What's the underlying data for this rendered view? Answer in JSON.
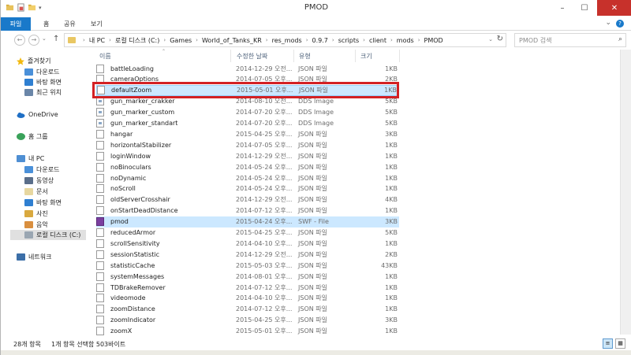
{
  "window": {
    "title": "PMOD",
    "controls": {
      "minimize": "–",
      "maximize": "☐",
      "close": "✕"
    }
  },
  "ribbon": {
    "tabs": [
      "파일",
      "홈",
      "공유",
      "보기"
    ],
    "help": "?",
    "expand": "⌄"
  },
  "address_bar": {
    "back": "←",
    "forward": "→",
    "recent": "⌄",
    "up": "↑",
    "breadcrumb": [
      "내 PC",
      "로컬 디스크 (C:)",
      "Games",
      "World_of_Tanks_KR",
      "res_mods",
      "0.9.7",
      "scripts",
      "client",
      "mods",
      "PMOD"
    ],
    "refresh": "↻",
    "search_placeholder": "PMOD 검색"
  },
  "nav_pane": {
    "favorites": {
      "label": "즐겨찾기",
      "items": [
        "다운로드",
        "바탕 화면",
        "최근 위치"
      ]
    },
    "onedrive": "OneDrive",
    "homegroup": "홈 그룹",
    "thispc": {
      "label": "내 PC",
      "items": [
        "다운로드",
        "동영상",
        "문서",
        "바탕 화면",
        "사진",
        "음악",
        "로컬 디스크 (C:)"
      ]
    },
    "network": "네트워크"
  },
  "file_list": {
    "columns": {
      "name": "이름",
      "date": "수정한 날짜",
      "type": "유형",
      "size": "크기"
    },
    "rows": [
      {
        "name": "battleLoading",
        "date": "2014-12-29 오전...",
        "type": "JSON 파일",
        "size": "1KB",
        "icon": "json"
      },
      {
        "name": "cameraOptions",
        "date": "2014-07-05 오후...",
        "type": "JSON 파일",
        "size": "2KB",
        "icon": "json"
      },
      {
        "name": "defaultZoom",
        "date": "2015-05-01 오후...",
        "type": "JSON 파일",
        "size": "1KB",
        "icon": "json"
      },
      {
        "name": "gun_marker_crakker",
        "date": "2014-08-10 오전...",
        "type": "DDS Image",
        "size": "5KB",
        "icon": "dds"
      },
      {
        "name": "gun_marker_custom",
        "date": "2014-07-20 오후...",
        "type": "DDS Image",
        "size": "5KB",
        "icon": "dds"
      },
      {
        "name": "gun_marker_standart",
        "date": "2014-07-20 오후...",
        "type": "DDS Image",
        "size": "5KB",
        "icon": "dds"
      },
      {
        "name": "hangar",
        "date": "2015-04-25 오후...",
        "type": "JSON 파일",
        "size": "3KB",
        "icon": "json"
      },
      {
        "name": "horizontalStabilizer",
        "date": "2014-07-05 오후...",
        "type": "JSON 파일",
        "size": "1KB",
        "icon": "json"
      },
      {
        "name": "loginWindow",
        "date": "2014-12-29 오전...",
        "type": "JSON 파일",
        "size": "1KB",
        "icon": "json"
      },
      {
        "name": "noBinoculars",
        "date": "2014-05-24 오후...",
        "type": "JSON 파일",
        "size": "1KB",
        "icon": "json"
      },
      {
        "name": "noDynamic",
        "date": "2014-05-24 오후...",
        "type": "JSON 파일",
        "size": "1KB",
        "icon": "json"
      },
      {
        "name": "noScroll",
        "date": "2014-05-24 오후...",
        "type": "JSON 파일",
        "size": "1KB",
        "icon": "json"
      },
      {
        "name": "oldServerCrosshair",
        "date": "2014-12-29 오전...",
        "type": "JSON 파일",
        "size": "4KB",
        "icon": "json"
      },
      {
        "name": "onStartDeadDistance",
        "date": "2014-07-12 오후...",
        "type": "JSON 파일",
        "size": "1KB",
        "icon": "json"
      },
      {
        "name": "pmod",
        "date": "2015-04-24 오후...",
        "type": "SWF - File",
        "size": "3KB",
        "icon": "swf"
      },
      {
        "name": "reducedArmor",
        "date": "2015-04-25 오후...",
        "type": "JSON 파일",
        "size": "5KB",
        "icon": "json"
      },
      {
        "name": "scrollSensitivity",
        "date": "2014-04-10 오후...",
        "type": "JSON 파일",
        "size": "1KB",
        "icon": "json"
      },
      {
        "name": "sessionStatistic",
        "date": "2014-12-29 오전...",
        "type": "JSON 파일",
        "size": "2KB",
        "icon": "json"
      },
      {
        "name": "statisticCache",
        "date": "2015-05-03 오후...",
        "type": "JSON 파일",
        "size": "43KB",
        "icon": "json"
      },
      {
        "name": "systemMessages",
        "date": "2014-08-01 오후...",
        "type": "JSON 파일",
        "size": "1KB",
        "icon": "json"
      },
      {
        "name": "TDBrakeRemover",
        "date": "2014-07-12 오후...",
        "type": "JSON 파일",
        "size": "1KB",
        "icon": "json"
      },
      {
        "name": "videomode",
        "date": "2014-04-10 오후...",
        "type": "JSON 파일",
        "size": "1KB",
        "icon": "json"
      },
      {
        "name": "zoomDistance",
        "date": "2014-07-12 오후...",
        "type": "JSON 파일",
        "size": "1KB",
        "icon": "json"
      },
      {
        "name": "zoomIndicator",
        "date": "2015-04-25 오후...",
        "type": "JSON 파일",
        "size": "3KB",
        "icon": "json"
      },
      {
        "name": "zoomX",
        "date": "2015-05-01 오후...",
        "type": "JSON 파일",
        "size": "1KB",
        "icon": "json"
      }
    ]
  },
  "status_bar": {
    "item_count": "28개 항목",
    "selection": "1개 항목 선택함 503바이트"
  },
  "colors": {
    "accent": "#1979ca",
    "highlight_box": "#d32124",
    "selection": "#cce8ff"
  }
}
